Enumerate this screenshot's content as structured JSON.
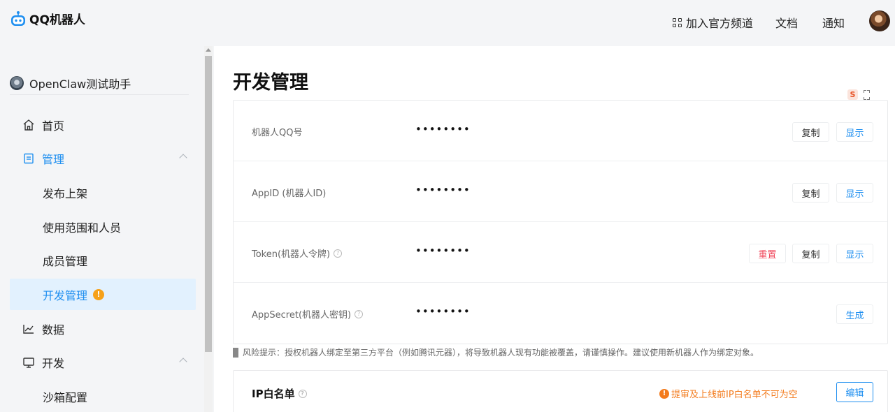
{
  "header": {
    "logo_text": "QQ机器人",
    "nav": {
      "channel": "加入官方频道",
      "docs": "文档",
      "notice": "通知"
    }
  },
  "sidebar": {
    "bot_name": "OpenClaw测试助手",
    "items": [
      {
        "label": "首页"
      },
      {
        "label": "管理"
      },
      {
        "label": "发布上架"
      },
      {
        "label": "使用范围和人员"
      },
      {
        "label": "成员管理"
      },
      {
        "label": "开发管理",
        "badge": "!"
      },
      {
        "label": "数据"
      },
      {
        "label": "开发"
      },
      {
        "label": "沙箱配置"
      }
    ]
  },
  "main": {
    "title": "开发管理",
    "credentials": [
      {
        "label": "机器人QQ号",
        "value": "••••••••",
        "actions": [
          "复制",
          "显示"
        ]
      },
      {
        "label": "AppID (机器人ID)",
        "value": "••••••••",
        "actions": [
          "复制",
          "显示"
        ]
      },
      {
        "label": "Token(机器人令牌)",
        "value": "••••••••",
        "actions": [
          "重置",
          "复制",
          "显示"
        ]
      },
      {
        "label": "AppSecret(机器人密钥)",
        "value": "••••••••",
        "actions": [
          "生成"
        ]
      }
    ],
    "risk_notice": "风险提示：授权机器人绑定至第三方平台（例如腾讯元器），将导致机器人现有功能被覆盖，请谨慎操作。建议使用新机器人作为绑定对象。",
    "ip_whitelist": {
      "title": "IP白名单",
      "warning": "提审及上线前IP白名单不可为空",
      "edit_label": "编辑"
    }
  },
  "colors": {
    "accent": "#1f8ff0",
    "danger": "#f0465a",
    "warning": "#f37b1d",
    "selected_bg": "#e2f1fe"
  }
}
